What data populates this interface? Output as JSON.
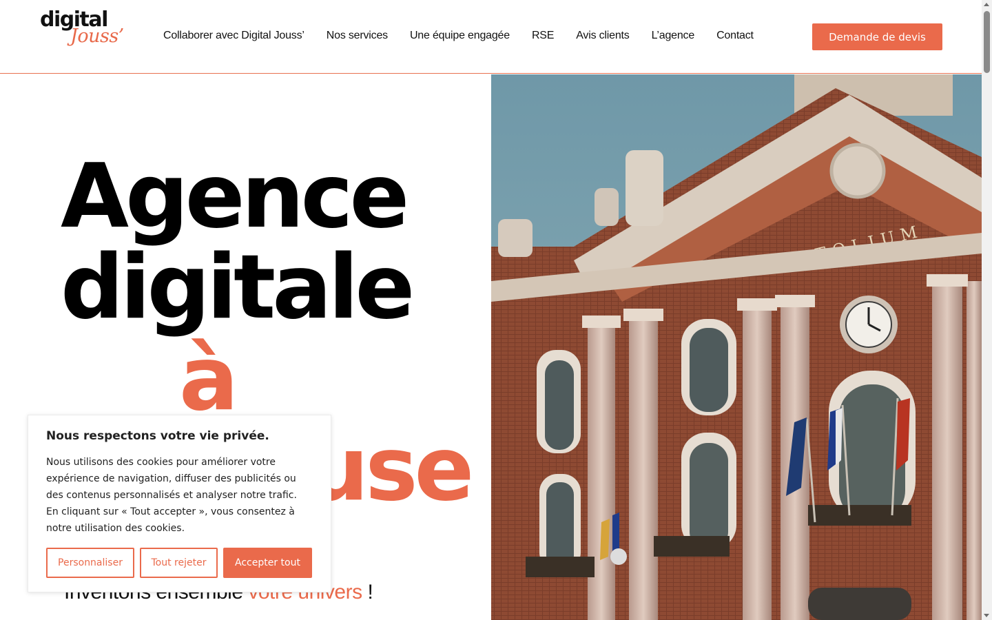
{
  "header": {
    "logo_line1": "digital",
    "logo_line2": "Jouss’",
    "nav": [
      {
        "label": "Collaborer avec Digital Jouss’"
      },
      {
        "label": "Nos services"
      },
      {
        "label": "Une équipe engagée"
      },
      {
        "label": "RSE"
      },
      {
        "label": "Avis clients"
      },
      {
        "label": "L’agence"
      },
      {
        "label": "Contact"
      }
    ],
    "cta_label": "Demande de devis"
  },
  "hero": {
    "title_line1": "Agence",
    "title_line2": "digitale",
    "title_line3": "à",
    "title_line4": "Toulouse",
    "subtitle_prefix": "Inventons ensemble",
    "subtitle_accent": "votre univers",
    "subtitle_suffix": "!",
    "photo_inscription": "CAPITOLIUM"
  },
  "cookie_banner": {
    "title": "Nous respectons votre vie privée.",
    "text": "Nous utilisons des cookies pour améliorer votre expérience de navigation, diffuser des publicités ou des contenus personnalisés et analyser notre trafic. En cliquant sur « Tout accepter », vous consentez à notre utilisation des cookies.",
    "customize_label": "Personnaliser",
    "reject_label": "Tout rejeter",
    "accept_label": "Accepter tout"
  },
  "colors": {
    "accent": "#ea6a4b",
    "text": "#111111",
    "background": "#ffffff"
  }
}
